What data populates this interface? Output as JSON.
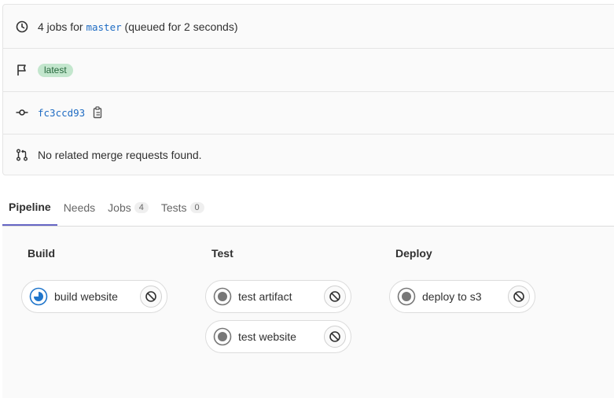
{
  "info": {
    "jobs_prefix": "4 jobs for",
    "branch": "master",
    "jobs_suffix": "(queued for 2 seconds)",
    "badge": "latest",
    "commit": "fc3ccd93",
    "merge_text": "No related merge requests found."
  },
  "tabs": [
    {
      "label": "Pipeline",
      "active": true
    },
    {
      "label": "Needs"
    },
    {
      "label": "Jobs",
      "count": "4"
    },
    {
      "label": "Tests",
      "count": "0"
    }
  ],
  "stages": [
    {
      "title": "Build",
      "jobs": [
        {
          "name": "build website",
          "status": "running"
        }
      ]
    },
    {
      "title": "Test",
      "jobs": [
        {
          "name": "test artifact",
          "status": "created"
        },
        {
          "name": "test website",
          "status": "created"
        }
      ]
    },
    {
      "title": "Deploy",
      "jobs": [
        {
          "name": "deploy to s3",
          "status": "created"
        }
      ]
    }
  ],
  "icons": {
    "row1": "clock-icon",
    "row2": "flag-icon",
    "row3": "commit-icon",
    "row4": "merge-request-icon",
    "copy": "copy-icon",
    "job_action": "cancel-icon"
  },
  "colors": {
    "accent_tab": "#6666c4",
    "badge_bg": "#c3e6cd",
    "link": "#1f6cc3",
    "running": "#1f75cb"
  }
}
